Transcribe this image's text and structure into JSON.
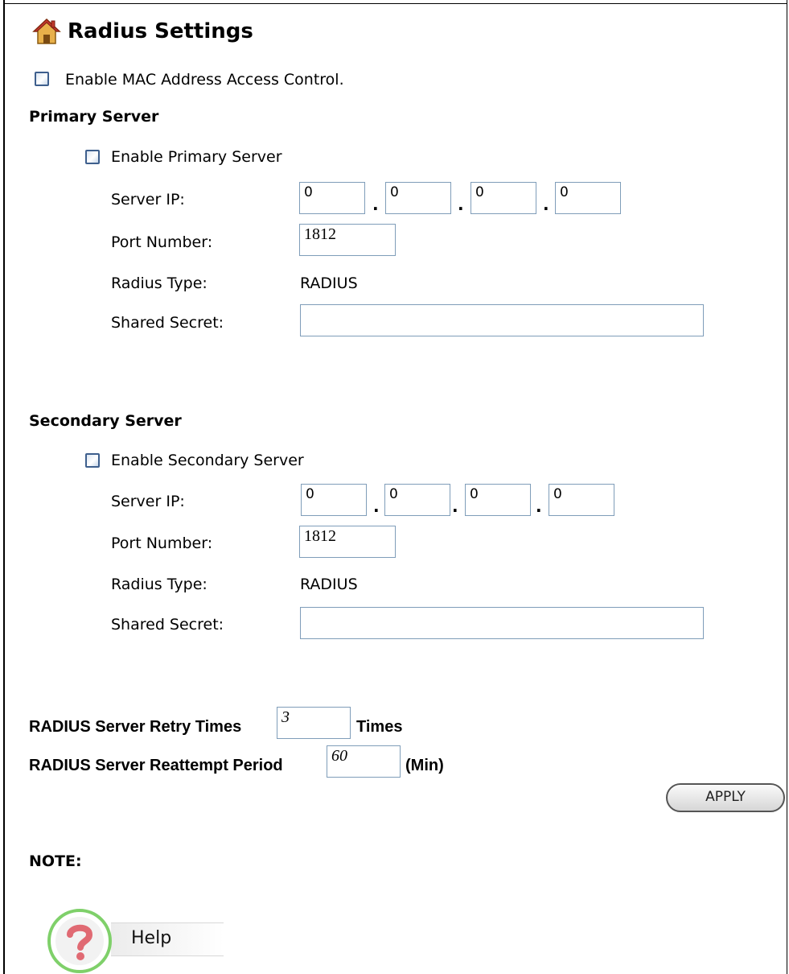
{
  "page": {
    "title": "Radius Settings",
    "mac_control_label": "Enable MAC Address Access Control."
  },
  "primary": {
    "heading": "Primary Server",
    "enable_label": "Enable Primary Server",
    "server_ip_label": "Server IP:",
    "ip": [
      "0",
      "0",
      "0",
      "0"
    ],
    "port_label": "Port Number:",
    "port": "1812",
    "radius_type_label": "Radius Type:",
    "radius_type": "RADIUS",
    "secret_label": "Shared Secret:",
    "secret": ""
  },
  "secondary": {
    "heading": "Secondary Server",
    "enable_label": "Enable Secondary Server",
    "server_ip_label": "Server IP:",
    "ip": [
      "0",
      "0",
      "0",
      "0"
    ],
    "port_label": "Port Number:",
    "port": "1812",
    "radius_type_label": "Radius Type:",
    "radius_type": "RADIUS",
    "secret_label": "Shared Secret:",
    "secret": ""
  },
  "retry": {
    "label": "RADIUS Server Retry Times",
    "value": "3",
    "unit": "Times"
  },
  "reattempt": {
    "label": "RADIUS Server Reattempt Period",
    "value": "60",
    "unit": "(Min)"
  },
  "apply_label": "APPLY",
  "note_label": "NOTE:",
  "help_label": "Help",
  "colors": {
    "checkbox_border": "#3e5f8d",
    "input_border": "#7f9db9",
    "help_ring": "#7fd06a",
    "help_icon": "#e06a73"
  }
}
